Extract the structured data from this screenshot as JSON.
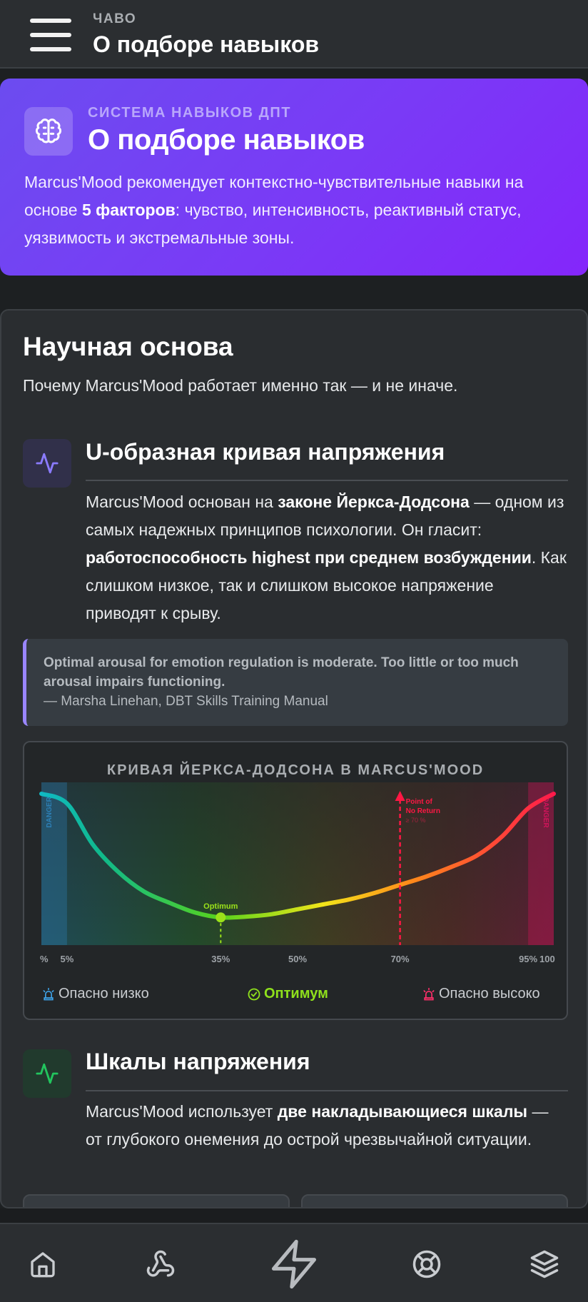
{
  "header": {
    "kicker": "ЧАВО",
    "title": "О подборе навыков"
  },
  "hero": {
    "icon": "brain-icon",
    "kicker": "СИСТЕМА НАВЫКОВ ДПТ",
    "title": "О подборе навыков",
    "text_1": "Marcus'Mood рекомендует контекстно-чувствительные навыки на основе ",
    "text_bold": "5 факторов",
    "text_2": ": чувство, интенсивность, реактивный статус, уязвимость и экстремальные зоны."
  },
  "science": {
    "title": "Научная основа",
    "subtitle": "Почему Marcus'Mood работает именно так — и не иначе.",
    "ucurve": {
      "icon": "activity-icon",
      "title": "U-образная кривая напряжения",
      "p1": "Marcus'Mood основан на ",
      "b1": "законе Йеркса-Додсона",
      "p2": " — одном из самых надежных принципов психологии. Он гласит: ",
      "b2": "работоспособность highest при среднем возбуждении",
      "p3": ". Как слишком низкое, так и слишком высокое напряжение приводят к срыву."
    },
    "quote": {
      "text": "Optimal arousal for emotion regulation is moderate. Too little or too much arousal impairs functioning.",
      "attribution": "— Marsha Linehan, DBT Skills Training Manual"
    },
    "scales": {
      "icon": "activity-icon",
      "title": "Шкалы напряжения",
      "p1": "Marcus'Mood использует ",
      "b1": "две накладывающиеся шкалы",
      "p2": " — от глубокого онемения до острой чрезвычайной ситуации."
    }
  },
  "chart_data": {
    "type": "line",
    "title": "КРИВАЯ ЙЕРКСА-ДОДСОНА В MARCUS'MOOD",
    "x": [
      0,
      5,
      10,
      15,
      20,
      25,
      30,
      35,
      40,
      45,
      50,
      55,
      60,
      65,
      70,
      75,
      80,
      85,
      90,
      95,
      100
    ],
    "y": [
      0.93,
      0.87,
      0.62,
      0.45,
      0.33,
      0.26,
      0.2,
      0.17,
      0.175,
      0.19,
      0.22,
      0.25,
      0.28,
      0.32,
      0.37,
      0.42,
      0.48,
      0.55,
      0.67,
      0.84,
      0.93
    ],
    "xlim": [
      0,
      100
    ],
    "ylim": [
      0,
      1
    ],
    "tick_labels": [
      "%",
      "5%",
      "35%",
      "50%",
      "70%",
      "95%",
      "100"
    ],
    "tick_values": [
      0,
      5,
      35,
      50,
      70,
      95,
      100
    ],
    "zones": [
      {
        "label": "DANGER",
        "from": 0,
        "to": 5,
        "color": "#2d7fb5"
      },
      {
        "label": "DANGER",
        "from": 95,
        "to": 100,
        "color": "#d0145a"
      }
    ],
    "annotations": [
      {
        "label": "Optimum",
        "x": 35,
        "color": "#9be21a"
      },
      {
        "label": "Point of",
        "label2": "No Return",
        "label3": "≥ 70 %",
        "x": 70,
        "color": "#ff1744"
      }
    ],
    "legend": [
      {
        "label": "Опасно низко",
        "icon": "siren-icon",
        "color": "#3ea1e6"
      },
      {
        "label": "Оптимум",
        "icon": "check-circle-icon",
        "color": "#8fe01c"
      },
      {
        "label": "Опасно высоко",
        "icon": "siren-icon",
        "color": "#ff2f6a"
      }
    ]
  },
  "nav": {
    "items": [
      "home-icon",
      "webhook-icon",
      "zap-icon",
      "lifebuoy-icon",
      "layers-icon"
    ]
  }
}
